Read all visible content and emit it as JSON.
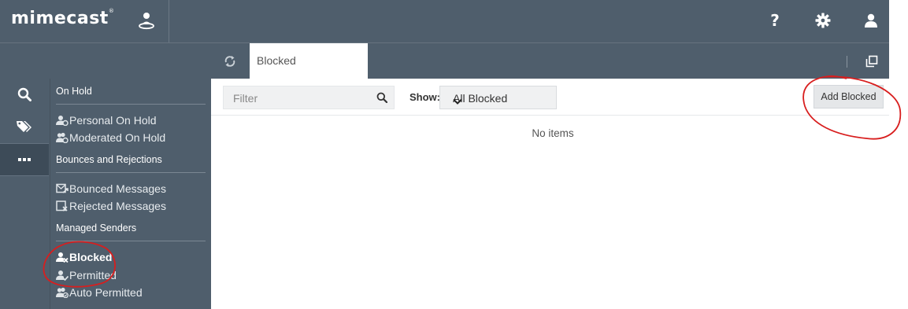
{
  "header": {
    "logo_text": "mimecast",
    "logo_mark": "®",
    "app_icon": "user-pin-icon",
    "help_label": "?",
    "settings_icon": "gear-icon",
    "user_icon": "user-icon"
  },
  "tabs": {
    "refresh_icon": "refresh-icon",
    "active_tab": "Blocked",
    "popout_icon": "popout-icon"
  },
  "leftnav": {
    "items": [
      {
        "icon": "search-icon"
      },
      {
        "icon": "tags-icon"
      },
      {
        "icon": "more-icon",
        "active": true
      }
    ]
  },
  "sidepanel": {
    "sections": [
      {
        "title": "On Hold",
        "items": [
          {
            "label": "Personal On Hold",
            "icon": "user-hold-icon"
          },
          {
            "label": "Moderated On Hold",
            "icon": "users-hold-icon"
          }
        ]
      },
      {
        "title": "Bounces and Rejections",
        "items": [
          {
            "label": "Bounced Messages",
            "icon": "bounced-icon"
          },
          {
            "label": "Rejected Messages",
            "icon": "rejected-icon"
          }
        ]
      },
      {
        "title": "Managed Senders",
        "items": [
          {
            "label": "Blocked",
            "icon": "user-blocked-icon",
            "active": true
          },
          {
            "label": "Permitted",
            "icon": "user-permitted-icon"
          },
          {
            "label": "Auto Permitted",
            "icon": "users-permitted-icon"
          }
        ]
      }
    ]
  },
  "toolbar": {
    "filter_placeholder": "Filter",
    "show_label": "Show:",
    "show_value": "All Blocked",
    "add_button": "Add Blocked"
  },
  "content": {
    "empty_text": "No items"
  },
  "colors": {
    "header_bg": "#4f5e6c",
    "annotation": "#d81e1e"
  }
}
